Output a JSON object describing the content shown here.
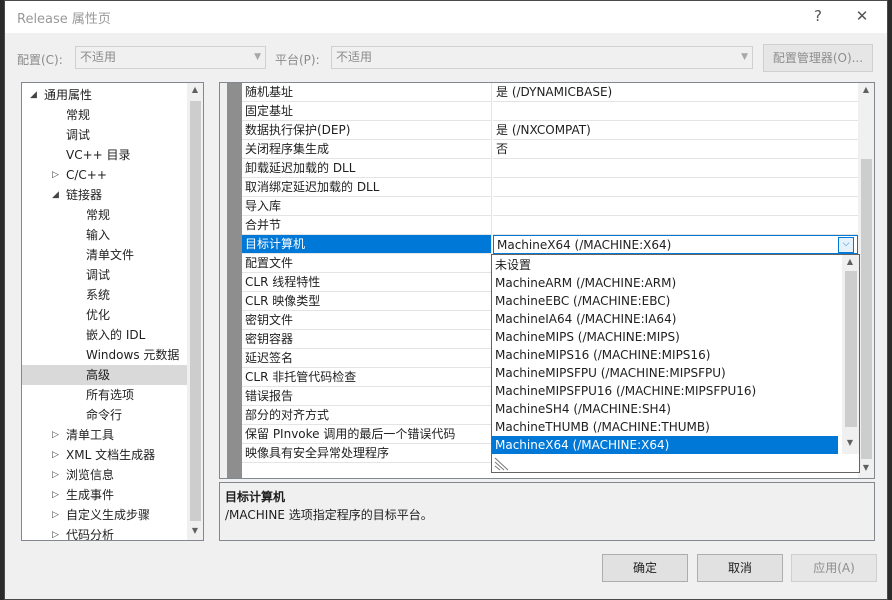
{
  "window": {
    "title": "Release 属性页",
    "help": "?",
    "close": "✕"
  },
  "toolbar": {
    "config_label": "配置(C):",
    "config_value": "不适用",
    "platform_label": "平台(P):",
    "platform_value": "不适用",
    "config_manager": "配置管理器(O)..."
  },
  "tree": {
    "items": [
      {
        "label": "通用属性",
        "level": 0,
        "expander": "open"
      },
      {
        "label": "常规",
        "level": 1
      },
      {
        "label": "调试",
        "level": 1
      },
      {
        "label": "VC++ 目录",
        "level": 1
      },
      {
        "label": "C/C++",
        "level": 1,
        "expander": "closed"
      },
      {
        "label": "链接器",
        "level": 1,
        "expander": "open"
      },
      {
        "label": "常规",
        "level": 2
      },
      {
        "label": "输入",
        "level": 2
      },
      {
        "label": "清单文件",
        "level": 2
      },
      {
        "label": "调试",
        "level": 2
      },
      {
        "label": "系统",
        "level": 2
      },
      {
        "label": "优化",
        "level": 2
      },
      {
        "label": "嵌入的 IDL",
        "level": 2
      },
      {
        "label": "Windows 元数据",
        "level": 2
      },
      {
        "label": "高级",
        "level": 2,
        "selected": true
      },
      {
        "label": "所有选项",
        "level": 2
      },
      {
        "label": "命令行",
        "level": 2
      },
      {
        "label": "清单工具",
        "level": 1,
        "expander": "closed"
      },
      {
        "label": "XML 文档生成器",
        "level": 1,
        "expander": "closed"
      },
      {
        "label": "浏览信息",
        "level": 1,
        "expander": "closed"
      },
      {
        "label": "生成事件",
        "level": 1,
        "expander": "closed"
      },
      {
        "label": "自定义生成步骤",
        "level": 1,
        "expander": "closed"
      },
      {
        "label": "代码分析",
        "level": 1,
        "expander": "closed"
      }
    ]
  },
  "grid": {
    "rows": [
      {
        "name": "随机基址",
        "value": "是 (/DYNAMICBASE)"
      },
      {
        "name": "固定基址",
        "value": ""
      },
      {
        "name": "数据执行保护(DEP)",
        "value": "是 (/NXCOMPAT)"
      },
      {
        "name": "关闭程序集生成",
        "value": "否"
      },
      {
        "name": "卸载延迟加载的 DLL",
        "value": ""
      },
      {
        "name": "取消绑定延迟加载的 DLL",
        "value": ""
      },
      {
        "name": "导入库",
        "value": ""
      },
      {
        "name": "合并节",
        "value": ""
      },
      {
        "name": "目标计算机",
        "value": "MachineX64 (/MACHINE:X64)",
        "selected": true
      },
      {
        "name": "配置文件",
        "value": ""
      },
      {
        "name": "CLR 线程特性",
        "value": ""
      },
      {
        "name": "CLR 映像类型",
        "value": ""
      },
      {
        "name": "密钥文件",
        "value": ""
      },
      {
        "name": "密钥容器",
        "value": ""
      },
      {
        "name": "延迟签名",
        "value": ""
      },
      {
        "name": "CLR 非托管代码检查",
        "value": ""
      },
      {
        "name": "错误报告",
        "value": ""
      },
      {
        "name": "部分的对齐方式",
        "value": ""
      },
      {
        "name": "保留 PInvoke 调用的最后一个错误代码",
        "value": ""
      },
      {
        "name": "映像具有安全异常处理程序",
        "value": ""
      }
    ]
  },
  "dropdown": {
    "options": [
      "未设置",
      "MachineARM (/MACHINE:ARM)",
      "MachineEBC (/MACHINE:EBC)",
      "MachineIA64 (/MACHINE:IA64)",
      "MachineMIPS (/MACHINE:MIPS)",
      "MachineMIPS16 (/MACHINE:MIPS16)",
      "MachineMIPSFPU (/MACHINE:MIPSFPU)",
      "MachineMIPSFPU16 (/MACHINE:MIPSFPU16)",
      "MachineSH4 (/MACHINE:SH4)",
      "MachineTHUMB (/MACHINE:THUMB)",
      "MachineX64 (/MACHINE:X64)"
    ],
    "selected_index": 10
  },
  "description": {
    "title": "目标计算机",
    "text": "/MACHINE 选项指定程序的目标平台。"
  },
  "buttons": {
    "ok": "确定",
    "cancel": "取消",
    "apply": "应用(A)"
  },
  "colors": {
    "selection": "#0078d7",
    "tree_selection": "#d9d9d9"
  }
}
